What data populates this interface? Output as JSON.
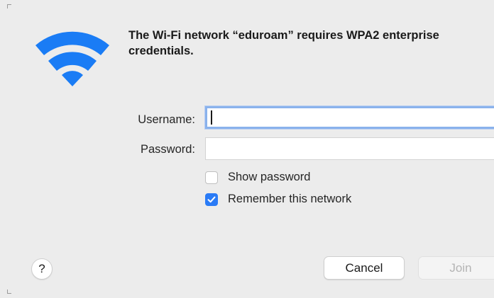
{
  "dialog": {
    "message": "The Wi-Fi network “eduroam” requires WPA2 enterprise credentials.",
    "icon": "wifi-icon",
    "accent_color": "#2a7bf6"
  },
  "form": {
    "username_label": "Username:",
    "username_value": "",
    "password_label": "Password:",
    "password_value": "",
    "show_password_label": "Show password",
    "show_password_checked": false,
    "remember_label": "Remember this network",
    "remember_checked": true
  },
  "buttons": {
    "help_label": "?",
    "cancel_label": "Cancel",
    "join_label": "Join",
    "join_enabled": false
  }
}
